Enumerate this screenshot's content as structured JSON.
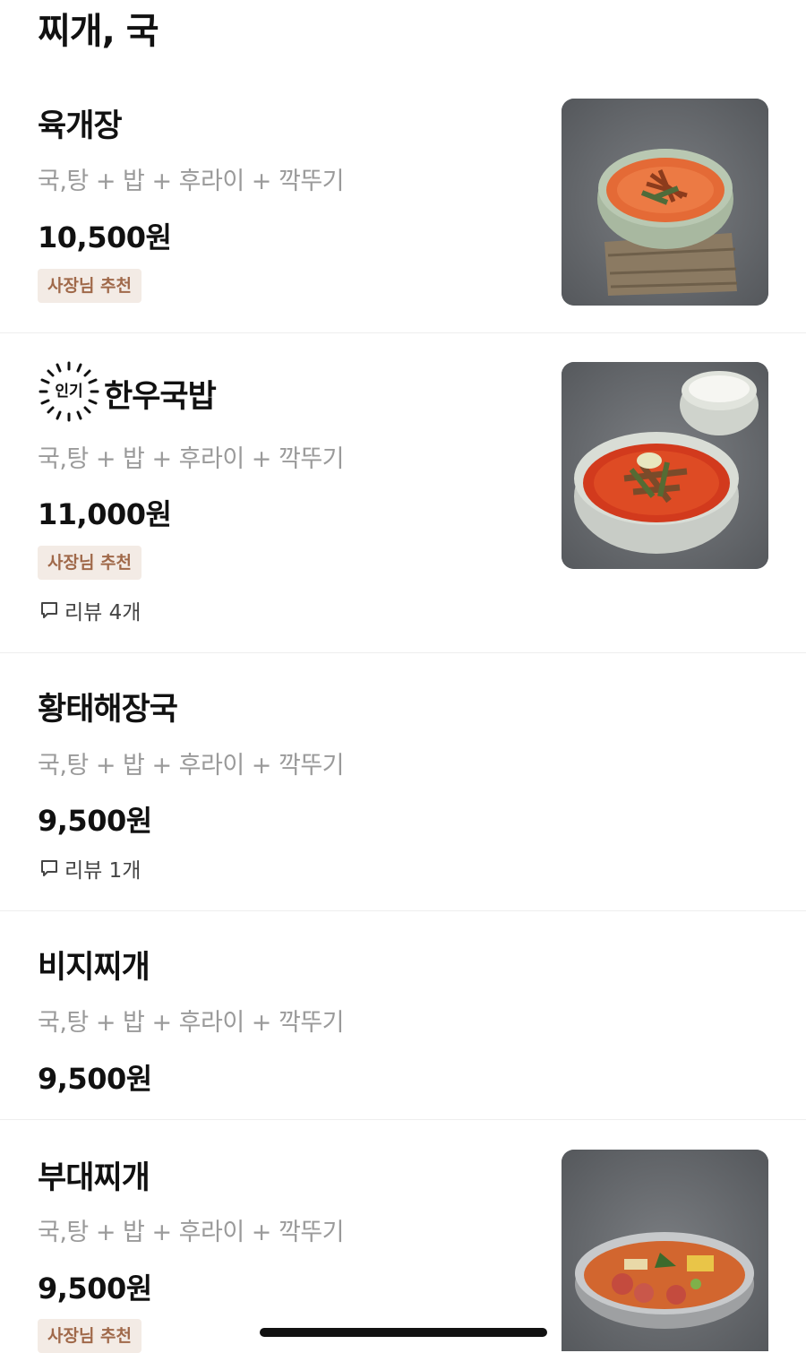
{
  "section": {
    "title": "찌개, 국"
  },
  "items": [
    {
      "name": "육개장",
      "desc": "국,탕 + 밥 + 후라이 + 깍뚜기",
      "price": "10,500원",
      "badge": "사장님 추천",
      "image_icon": "yukgaejang-photo"
    },
    {
      "popular_label": "인기",
      "name": "한우국밥",
      "desc": "국,탕 + 밥 + 후라이 + 깍뚜기",
      "price": "11,000원",
      "badge": "사장님 추천",
      "review": "리뷰 4개",
      "image_icon": "hanwoo-gukbap-photo"
    },
    {
      "name": "황태해장국",
      "desc": "국,탕 + 밥 + 후라이 + 깍뚜기",
      "price": "9,500원",
      "review": "리뷰 1개"
    },
    {
      "name": "비지찌개",
      "desc": "국,탕 + 밥 + 후라이 + 깍뚜기",
      "price": "9,500원"
    },
    {
      "name": "부대찌개",
      "desc": "국,탕 + 밥 + 후라이 + 깍뚜기",
      "price": "9,500원",
      "badge": "사장님 추천",
      "image_icon": "budae-jjigae-photo"
    }
  ],
  "colors": {
    "badge_bg": "#f3ebe5",
    "badge_text": "#a0694a",
    "desc_text": "#9a9a9a",
    "divider": "#eeeeee"
  }
}
